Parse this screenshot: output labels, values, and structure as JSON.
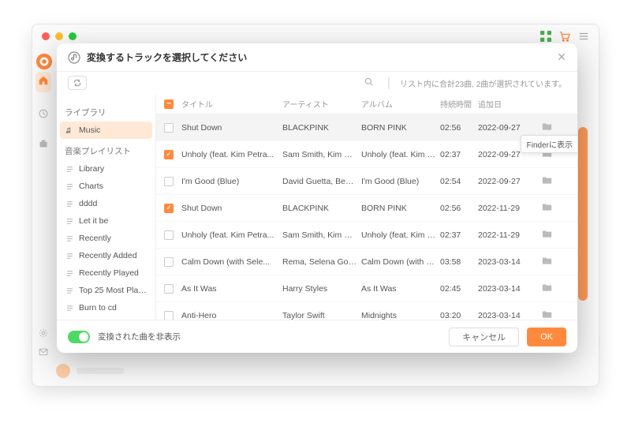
{
  "modal": {
    "title": "変換するトラックを選択してください",
    "status_message": "リスト内に合計23曲, 2曲が選択されています。",
    "tooltip": "Finderに表示"
  },
  "sidebar": {
    "sections": [
      {
        "label": "ライブラリ",
        "items": [
          {
            "label": "Music",
            "icon": "music-note-icon",
            "selected": true
          }
        ]
      },
      {
        "label": "音楽プレイリスト",
        "items": [
          {
            "label": "Library",
            "icon": "playlist-icon"
          },
          {
            "label": "Charts",
            "icon": "playlist-icon"
          },
          {
            "label": "dddd",
            "icon": "playlist-icon"
          },
          {
            "label": "Let it be",
            "icon": "playlist-icon"
          },
          {
            "label": "Recently",
            "icon": "playlist-icon"
          },
          {
            "label": "Recently Added",
            "icon": "playlist-icon"
          },
          {
            "label": "Recently Played",
            "icon": "playlist-icon"
          },
          {
            "label": "Top 25 Most Played",
            "icon": "playlist-icon"
          },
          {
            "label": "Burn to cd",
            "icon": "playlist-icon"
          }
        ]
      }
    ]
  },
  "table": {
    "columns": {
      "title": "タイトル",
      "artist": "アーティスト",
      "album": "アルバム",
      "duration": "持続時間",
      "date": "追加日"
    },
    "rows": [
      {
        "checked": false,
        "hovered": true,
        "title": "Shut Down",
        "artist": "BLACKPINK",
        "album": "BORN PINK",
        "duration": "02:56",
        "date": "2022-09-27"
      },
      {
        "checked": true,
        "title": "Unholy (feat. Kim Petra...",
        "artist": "Sam Smith, Kim Pe...",
        "album": "Unholy (feat. Kim P...",
        "duration": "02:37",
        "date": "2022-09-27"
      },
      {
        "checked": false,
        "title": "I'm Good (Blue)",
        "artist": "David Guetta, Beb...",
        "album": "I'm Good (Blue)",
        "duration": "02:54",
        "date": "2022-09-27"
      },
      {
        "checked": true,
        "title": "Shut Down",
        "artist": "BLACKPINK",
        "album": "BORN PINK",
        "duration": "02:56",
        "date": "2022-11-29"
      },
      {
        "checked": false,
        "title": "Unholy (feat. Kim Petra...",
        "artist": "Sam Smith, Kim Pe...",
        "album": "Unholy (feat. Kim P...",
        "duration": "02:37",
        "date": "2022-11-29"
      },
      {
        "checked": false,
        "title": "Calm Down (with Sele...",
        "artist": "Rema, Selena Gom...",
        "album": "Calm Down (with S...",
        "duration": "03:58",
        "date": "2023-03-14"
      },
      {
        "checked": false,
        "title": "As It Was",
        "artist": "Harry Styles",
        "album": "As It Was",
        "duration": "02:45",
        "date": "2023-03-14"
      },
      {
        "checked": false,
        "title": "Anti-Hero",
        "artist": "Taylor Swift",
        "album": "Midnights",
        "duration": "03:20",
        "date": "2023-03-14"
      }
    ]
  },
  "footer": {
    "toggle_label": "変換された曲を非表示",
    "cancel": "キャンセル",
    "ok": "OK"
  }
}
